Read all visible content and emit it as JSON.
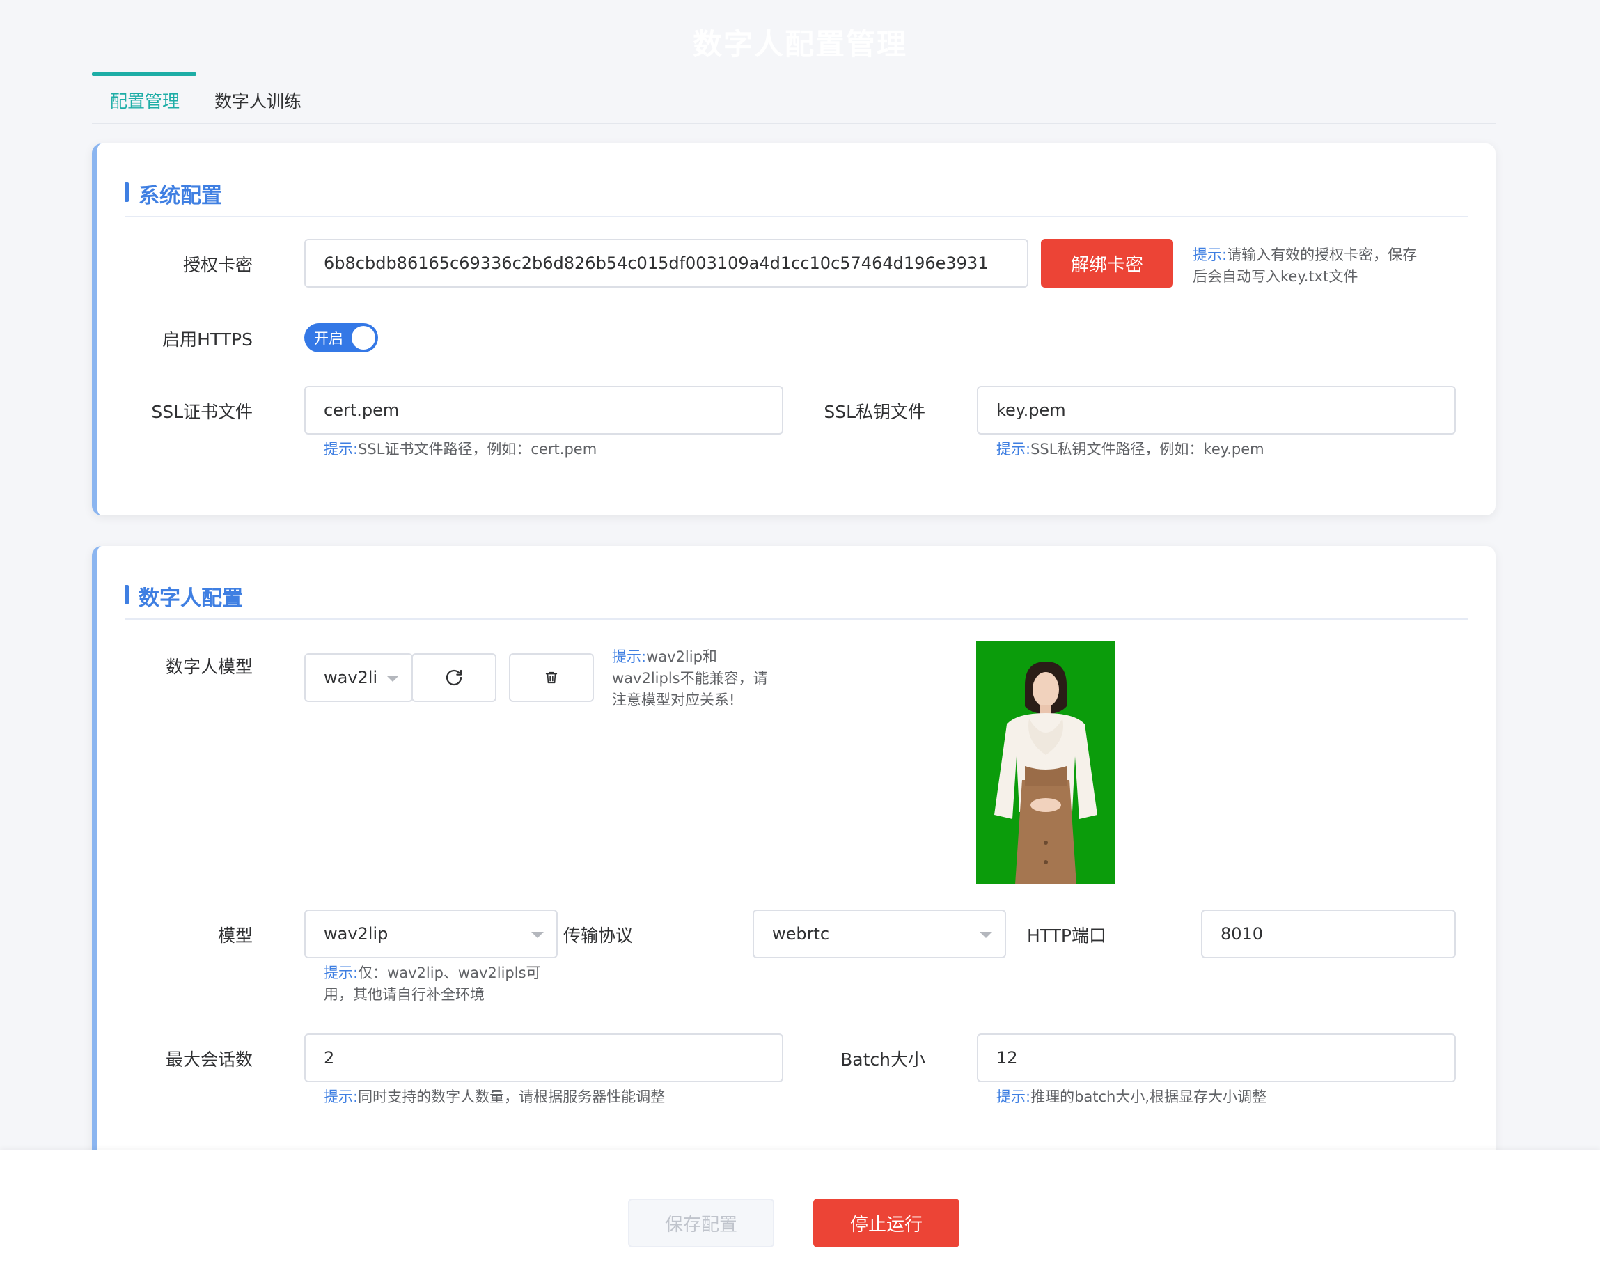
{
  "page_title": "数字人配置管理",
  "tabs": [
    {
      "label": "配置管理",
      "active": true
    },
    {
      "label": "数字人训练",
      "active": false
    }
  ],
  "system_config": {
    "title": "系统配置",
    "license_label": "授权卡密",
    "license_value": "6b8cbdb86165c69336c2b6d826b54c015df003109a4d1cc10c57464d196e3931",
    "unbind_button": "解绑卡密",
    "license_hint_key": "提示:",
    "license_hint_line1": "请输入有效的授权卡密，保存",
    "license_hint_line2": "后会自动写入key.txt文件",
    "https_label": "启用HTTPS",
    "https_toggle_text": "开启",
    "ssl_cert_label": "SSL证书文件",
    "ssl_cert_value": "cert.pem",
    "ssl_cert_hint_key": "提示:",
    "ssl_cert_hint": "SSL证书文件路径，例如：cert.pem",
    "ssl_key_label": "SSL私钥文件",
    "ssl_key_value": "key.pem",
    "ssl_key_hint_key": "提示:",
    "ssl_key_hint": "SSL私钥文件路径，例如：key.pem"
  },
  "avatar_config": {
    "title": "数字人配置",
    "avatar_model_label": "数字人模型",
    "avatar_model_value": "wav2li",
    "avatar_hint_key": "提示:",
    "avatar_hint_line1": "wav2lip和",
    "avatar_hint_line2": "wav2lipls不能兼容，请",
    "avatar_hint_line3": "注意模型对应关系!",
    "model_label": "模型",
    "model_value": "wav2lip",
    "model_hint_key": "提示:",
    "model_hint_line1": "仅：wav2lip、wav2lipls可",
    "model_hint_line2": "用，其他请自行补全环境",
    "transport_label": "传输协议",
    "transport_value": "webrtc",
    "http_port_label": "HTTP端口",
    "http_port_value": "8010",
    "max_sessions_label": "最大会话数",
    "max_sessions_value": "2",
    "max_sessions_hint_key": "提示:",
    "max_sessions_hint": "同时支持的数字人数量，请根据服务器性能调整",
    "batch_label": "Batch大小",
    "batch_value": "12",
    "batch_hint_key": "提示:",
    "batch_hint": "推理的batch大小,根据显存大小调整"
  },
  "footer": {
    "save_button": "保存配置",
    "stop_button": "停止运行"
  },
  "colors": {
    "accent": "#3f7fe2",
    "danger": "#ec4436",
    "tab_active": "#1dada6",
    "avatar_bg": "#0b9c0b"
  },
  "icons": [
    "refresh-icon",
    "trash-icon",
    "chevron-down-icon"
  ]
}
